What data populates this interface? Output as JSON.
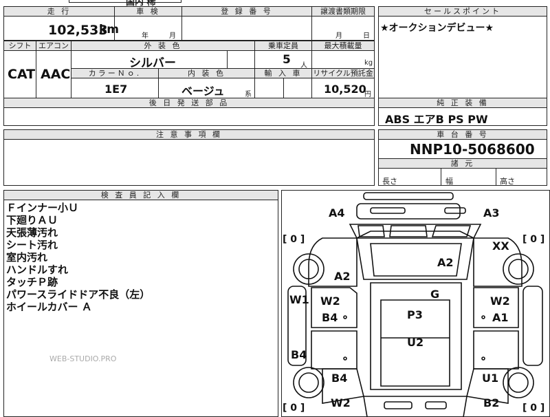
{
  "top_fragment": "国内 稀",
  "mileage": {
    "header": "走 行",
    "value": "102,533",
    "unit": "km"
  },
  "inspection": {
    "header": "車 検",
    "year_unit": "年",
    "month_unit": "月"
  },
  "registration": {
    "header": "登 録 番 号"
  },
  "transfer": {
    "header": "譲渡書類期限",
    "month_unit": "月",
    "day_unit": "日"
  },
  "selling_point": {
    "header": "セールスポイント",
    "text": "★オークションデビュー★"
  },
  "shift": {
    "header": "シフト",
    "value": "CAT"
  },
  "ac": {
    "header": "エアコン",
    "value": "AAC"
  },
  "exterior": {
    "header": "外 装 色",
    "value": "シルバー"
  },
  "capacity": {
    "header": "乗車定員",
    "value": "5",
    "unit": "人"
  },
  "load": {
    "header": "最大積載量",
    "unit": "kg"
  },
  "color_no": {
    "header": "カラーＮｏ.",
    "value": "1E7"
  },
  "interior": {
    "header": "内 装 色",
    "value": "ベージュ",
    "suffix": "系"
  },
  "import": {
    "header": "輸 入 車"
  },
  "recycle": {
    "header": "リサイクル預託金",
    "value": "10,520",
    "unit": "円"
  },
  "later_parts": {
    "header": "後 日 発 送 部 品"
  },
  "equipment": {
    "header": "純 正 装 備",
    "value": "ABS エアB PS PW"
  },
  "notes": {
    "header": "注 意 事 項 欄"
  },
  "chassis": {
    "header": "車 台 番 号",
    "value": "NNP10-5068600"
  },
  "dims": {
    "header": "諸 元",
    "length": "長さ",
    "width": "幅",
    "height": "高さ"
  },
  "inspector": {
    "header": "検 査 員 記 入 欄",
    "lines": [
      "Ｆインナー小Ｕ",
      "下廻りＡＵ",
      "天張薄汚れ",
      "シート汚れ",
      "室内汚れ",
      "ハンドルすれ",
      "タッチＰ跡",
      "パワースライドドア不良（左）",
      "ホイールカバー Ａ"
    ]
  },
  "watermark": "WEB-STUDIO.PRO",
  "diagram": {
    "bracket_left_top": "[ 0 ]",
    "bracket_right_top": "[ 0 ]",
    "bracket_left_bottom": "[ 0 ]",
    "bracket_right_bottom": "[ 0 ]",
    "marks": {
      "a4": "A4",
      "a3": "A3",
      "xx": "XX",
      "a2_roof": "A2",
      "a2_left": "A2",
      "g": "G",
      "w1": "W1",
      "w2_ld": "W2",
      "b4_ld": "B4",
      "w2_rd": "W2",
      "a1_rd": "A1",
      "p3": "P3",
      "u2": "U2",
      "b4_side": "B4",
      "b4_rear": "B4",
      "u1": "U1",
      "w2_bottom": "W2",
      "b2": "B2"
    }
  }
}
